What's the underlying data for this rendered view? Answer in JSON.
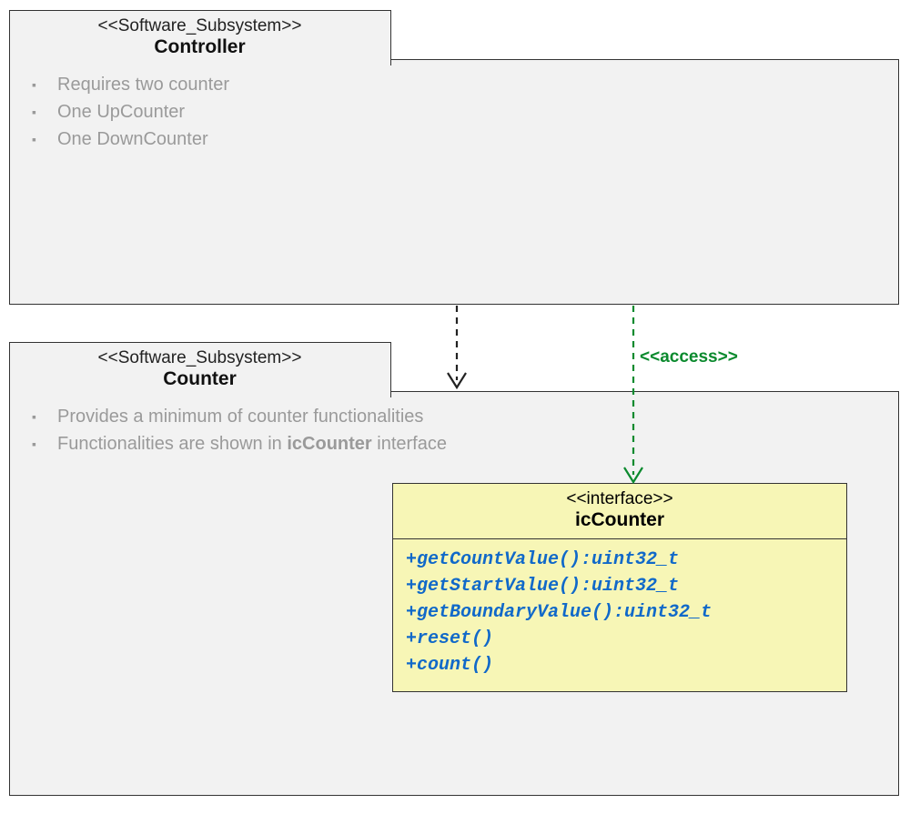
{
  "controller": {
    "stereotype": "<<Software_Subsystem>>",
    "name": "Controller",
    "bullets": [
      "Requires two counter",
      "One UpCounter",
      "One DownCounter"
    ]
  },
  "counter": {
    "stereotype": "<<Software_Subsystem>>",
    "name": "Counter",
    "bullet1_prefix": "Provides a minimum of counter functionalities",
    "bullet2_prefix": "Functionalities are shown in ",
    "bullet2_bold": "icCounter",
    "bullet2_suffix": " interface"
  },
  "interface": {
    "stereotype": "<<interface>>",
    "name": "icCounter",
    "ops": [
      "+getCountValue():uint32_t",
      "+getStartValue():uint32_t",
      "+getBoundaryValue():uint32_t",
      "+reset()",
      "+count()"
    ]
  },
  "access_label": "<<access>>"
}
